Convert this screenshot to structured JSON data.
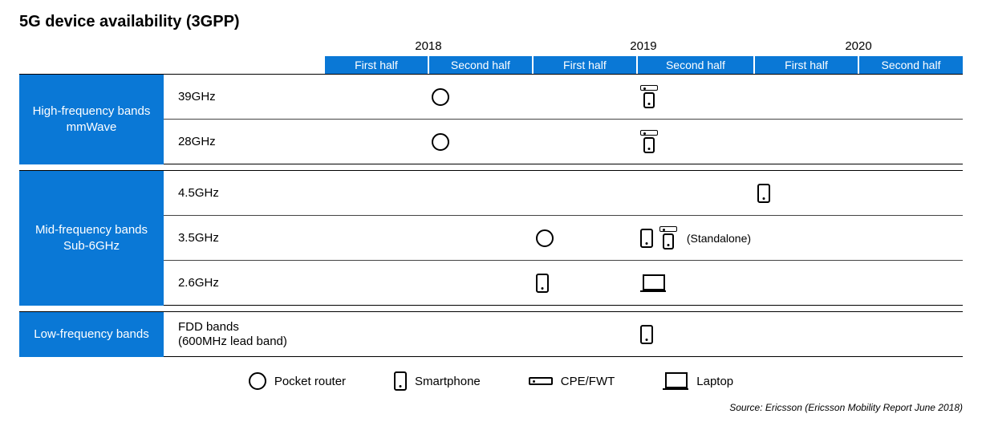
{
  "title": "5G device availability (3GPP)",
  "years": [
    "2018",
    "2019",
    "2020"
  ],
  "halves": [
    "First half",
    "Second half"
  ],
  "groups": [
    {
      "label_line1": "High-frequency bands",
      "label_line2": "mmWave",
      "rows": [
        {
          "freq": "39GHz",
          "cells": [
            "",
            "circle",
            "",
            "cpe_phone",
            "",
            ""
          ]
        },
        {
          "freq": "28GHz",
          "cells": [
            "",
            "circle",
            "",
            "cpe_phone",
            "",
            ""
          ]
        }
      ]
    },
    {
      "label_line1": "Mid-frequency bands",
      "label_line2": "Sub-6GHz",
      "rows": [
        {
          "freq": "4.5GHz",
          "cells": [
            "",
            "",
            "",
            "",
            "phone",
            ""
          ]
        },
        {
          "freq": "3.5GHz",
          "cells": [
            "",
            "",
            "circle",
            "phone_cpe_phone_standalone",
            "",
            ""
          ]
        },
        {
          "freq": "2.6GHz",
          "cells": [
            "",
            "",
            "phone",
            "laptop",
            "",
            ""
          ]
        }
      ]
    },
    {
      "label_line1": "Low-frequency bands",
      "label_line2": "",
      "rows": [
        {
          "freq_line1": "FDD bands",
          "freq_line2": "(600MHz lead band)",
          "cells": [
            "",
            "",
            "",
            "phone",
            "",
            ""
          ]
        }
      ]
    }
  ],
  "standalone_note": "(Standalone)",
  "legend": [
    {
      "icon": "circle",
      "label": "Pocket router"
    },
    {
      "icon": "phone",
      "label": "Smartphone"
    },
    {
      "icon": "cpe",
      "label": "CPE/FWT"
    },
    {
      "icon": "laptop",
      "label": "Laptop"
    }
  ],
  "source": "Source: Ericsson (Ericsson Mobility Report June 2018)",
  "chart_data": {
    "type": "table",
    "title": "5G device availability (3GPP)",
    "time_columns": [
      "2018 H1",
      "2018 H2",
      "2019 H1",
      "2019 H2",
      "2020 H1",
      "2020 H2"
    ],
    "device_types": [
      "pocket_router",
      "smartphone",
      "cpe_fwt",
      "laptop"
    ],
    "rows": [
      {
        "group": "High-frequency bands mmWave",
        "frequency": "39GHz",
        "availability": {
          "2018 H2": [
            "pocket_router"
          ],
          "2019 H2": [
            "cpe_fwt",
            "smartphone"
          ]
        }
      },
      {
        "group": "High-frequency bands mmWave",
        "frequency": "28GHz",
        "availability": {
          "2018 H2": [
            "pocket_router"
          ],
          "2019 H2": [
            "cpe_fwt",
            "smartphone"
          ]
        }
      },
      {
        "group": "Mid-frequency bands Sub-6GHz",
        "frequency": "4.5GHz",
        "availability": {
          "2020 H1": [
            "smartphone"
          ]
        }
      },
      {
        "group": "Mid-frequency bands Sub-6GHz",
        "frequency": "3.5GHz",
        "availability": {
          "2019 H1": [
            "pocket_router"
          ],
          "2019 H2": [
            "smartphone",
            "cpe_fwt",
            "smartphone"
          ]
        },
        "note": "Standalone"
      },
      {
        "group": "Mid-frequency bands Sub-6GHz",
        "frequency": "2.6GHz",
        "availability": {
          "2019 H1": [
            "smartphone"
          ],
          "2019 H2": [
            "laptop"
          ]
        }
      },
      {
        "group": "Low-frequency bands",
        "frequency": "FDD bands (600MHz lead band)",
        "availability": {
          "2019 H2": [
            "smartphone"
          ]
        }
      }
    ],
    "source": "Ericsson Mobility Report June 2018"
  }
}
